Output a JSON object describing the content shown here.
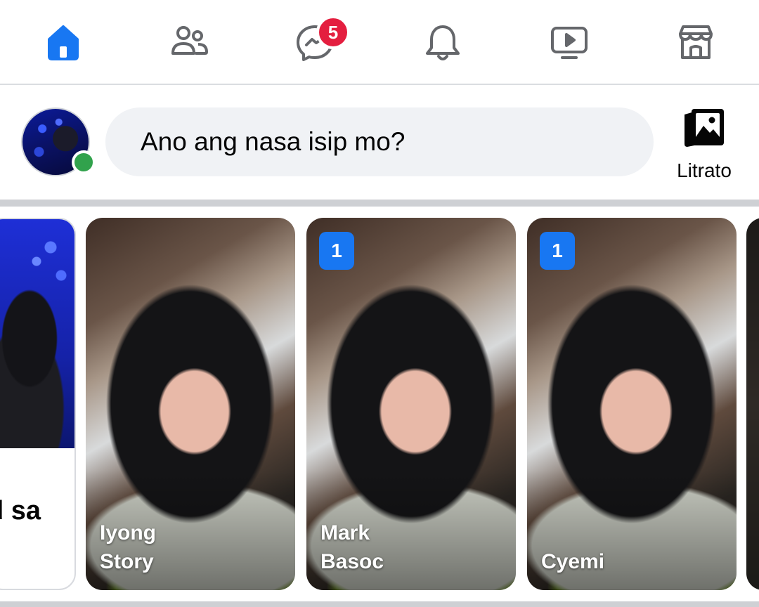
{
  "nav": {
    "items": [
      {
        "name": "home",
        "icon": "home-icon",
        "active": true
      },
      {
        "name": "friends",
        "icon": "friends-icon",
        "active": false
      },
      {
        "name": "messenger",
        "icon": "messenger-icon",
        "active": false,
        "badge": "5"
      },
      {
        "name": "notifications",
        "icon": "bell-icon",
        "active": false
      },
      {
        "name": "watch",
        "icon": "video-icon",
        "active": false
      },
      {
        "name": "marketplace",
        "icon": "marketplace-icon",
        "active": false
      }
    ],
    "active_color": "#1877f2",
    "inactive_color": "#65676b",
    "badge_color": "#e41e3f"
  },
  "composer": {
    "placeholder": "Ano ang nasa isip mo?",
    "photo_label": "Litrato",
    "online": true,
    "online_color": "#31a24c"
  },
  "stories": {
    "create": {
      "line1": "d sa",
      "line2": "/"
    },
    "cards": [
      {
        "name_line1": "Iyong",
        "name_line2": "Story",
        "count": ""
      },
      {
        "name_line1": "Mark",
        "name_line2": "Basoc",
        "count": "1"
      },
      {
        "name_line1": "",
        "name_line2": "Cyemi",
        "count": "1"
      }
    ]
  }
}
